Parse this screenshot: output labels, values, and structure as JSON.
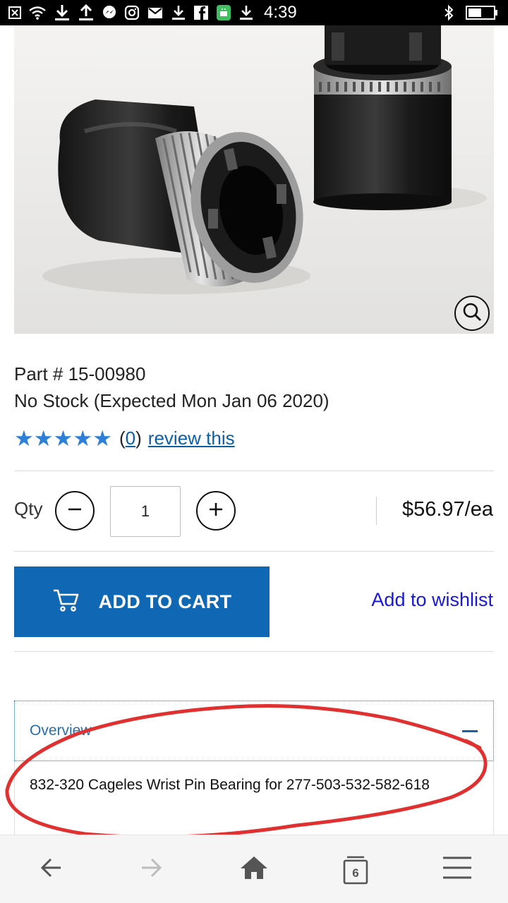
{
  "status_bar": {
    "time": "4:39",
    "icons": [
      "close-box-icon",
      "wifi-icon",
      "download-icon",
      "upload-icon",
      "messenger-icon",
      "instagram-icon",
      "gmail-icon",
      "download-icon",
      "facebook-icon",
      "android-icon",
      "download-icon",
      "bluetooth-icon",
      "battery-icon"
    ]
  },
  "product": {
    "part_number": "Part # 15-00980",
    "stock_status": "No Stock (Expected Mon Jan 06 2020)",
    "rating_stars": 5,
    "review_count_open": "(",
    "review_count": "0",
    "review_count_close": ")",
    "review_link": "review this"
  },
  "purchase": {
    "qty_label": "Qty",
    "qty_value": "1",
    "price": "$56.97/ea",
    "add_to_cart_label": "ADD TO CART",
    "wishlist_label": "Add to wishlist",
    "accent_color": "#1067b4"
  },
  "overview": {
    "title": "Overview",
    "description": "832-320 Cageles Wrist Pin Bearing for 277-503-532-582-618"
  },
  "bottom_nav": {
    "tab_count": "6",
    "icons": [
      "back-arrow-icon",
      "forward-arrow-icon",
      "home-icon",
      "tabs-icon",
      "menu-icon"
    ]
  }
}
